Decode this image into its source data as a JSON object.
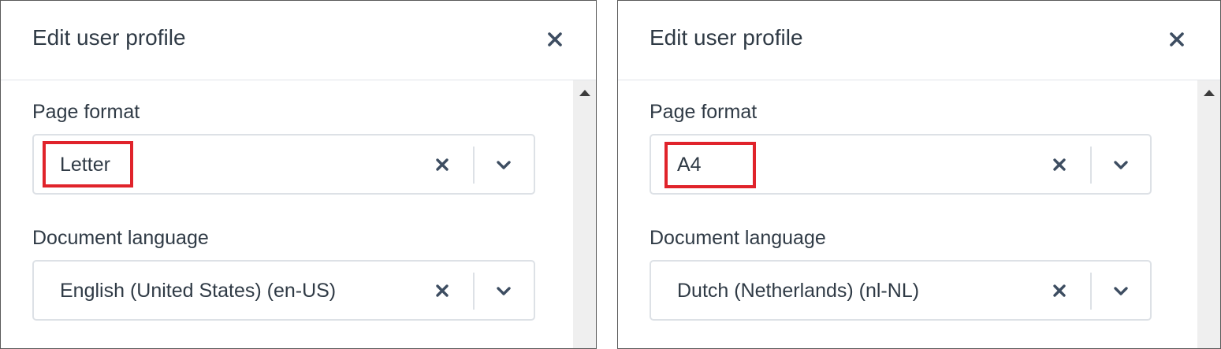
{
  "colors": {
    "text": "#2f3a45",
    "icon": "#3d4d61",
    "border": "#dde1e6",
    "scrollbar": "#efefef",
    "highlight": "#e0232b"
  },
  "panels": [
    {
      "title": "Edit user profile",
      "page_format": {
        "label": "Page format",
        "value": "Letter"
      },
      "document_language": {
        "label": "Document language",
        "value": "English (United States) (en-US)"
      }
    },
    {
      "title": "Edit user profile",
      "page_format": {
        "label": "Page format",
        "value": "A4"
      },
      "document_language": {
        "label": "Document language",
        "value": "Dutch (Netherlands) (nl-NL)"
      }
    }
  ],
  "icons": {
    "close": "close-icon",
    "clear": "clear-icon",
    "dropdown": "chevron-down-icon",
    "scroll_up": "scroll-up-arrow"
  }
}
